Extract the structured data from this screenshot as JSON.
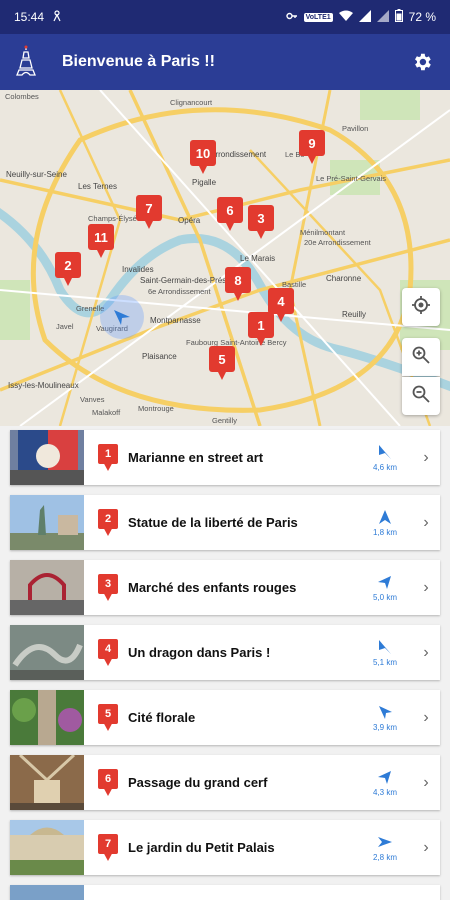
{
  "status_bar": {
    "time": "15:44",
    "volte": "VoLTE1",
    "battery": "72 %"
  },
  "app_bar": {
    "title": "Bienvenue à Paris !!",
    "logo_icon": "eiffel-tower-icon",
    "settings_icon": "gear-icon"
  },
  "map": {
    "labels": {
      "colombes": "Colombes",
      "clignancourt": "Clignancourt",
      "arr18": "18e Arrondissement",
      "le_bo": "Le Bo",
      "pavillon": "Pavillon",
      "neuilly": "Neuilly-sur-Seine",
      "les_ternes": "Les Ternes",
      "pigalle": "Pigalle",
      "le_pre": "Le Pré-Saint-Gervais",
      "champs": "Champs-Élysées",
      "opera": "Opéra",
      "menilmontant": "Ménilmontant",
      "arr20": "20e Arrondissement",
      "le_marais": "Le Marais",
      "invalides": "Invalides",
      "saint_germain": "Saint-Germain-des-Prés",
      "arr6": "6e Arrondissement",
      "charonne": "Charonne",
      "bastille": "Bastille",
      "grenelle": "Grenelle",
      "javel": "Javel",
      "vaugirard": "Vaugirard",
      "montparnasse": "Montparnasse",
      "reuilly": "Reuilly",
      "faubourg": "Faubourg Saint-Antoine Bercy",
      "plaisance": "Plaisance",
      "issy": "Issy-les-Moulineaux",
      "montrouge": "Montrouge",
      "malakoff": "Malakoff",
      "vanves": "Vanves",
      "gentilly": "Gentilly"
    },
    "pins": [
      "1",
      "2",
      "3",
      "4",
      "5",
      "6",
      "7",
      "8",
      "9",
      "10",
      "11"
    ],
    "buttons": {
      "locate": "my-location-icon",
      "zoom_in": "zoom-in-icon",
      "zoom_out": "zoom-out-icon"
    }
  },
  "places": [
    {
      "num": "1",
      "title": "Marianne en street art",
      "distance": "4,6 km"
    },
    {
      "num": "2",
      "title": "Statue de la liberté de Paris",
      "distance": "1,8 km"
    },
    {
      "num": "3",
      "title": "Marché des enfants rouges",
      "distance": "5,0 km"
    },
    {
      "num": "4",
      "title": "Un dragon dans Paris !",
      "distance": "5,1 km"
    },
    {
      "num": "5",
      "title": "Cité florale",
      "distance": "3,9 km"
    },
    {
      "num": "6",
      "title": "Passage du grand cerf",
      "distance": "4,3 km"
    },
    {
      "num": "7",
      "title": "Le jardin du Petit Palais",
      "distance": "2,8 km"
    }
  ]
}
